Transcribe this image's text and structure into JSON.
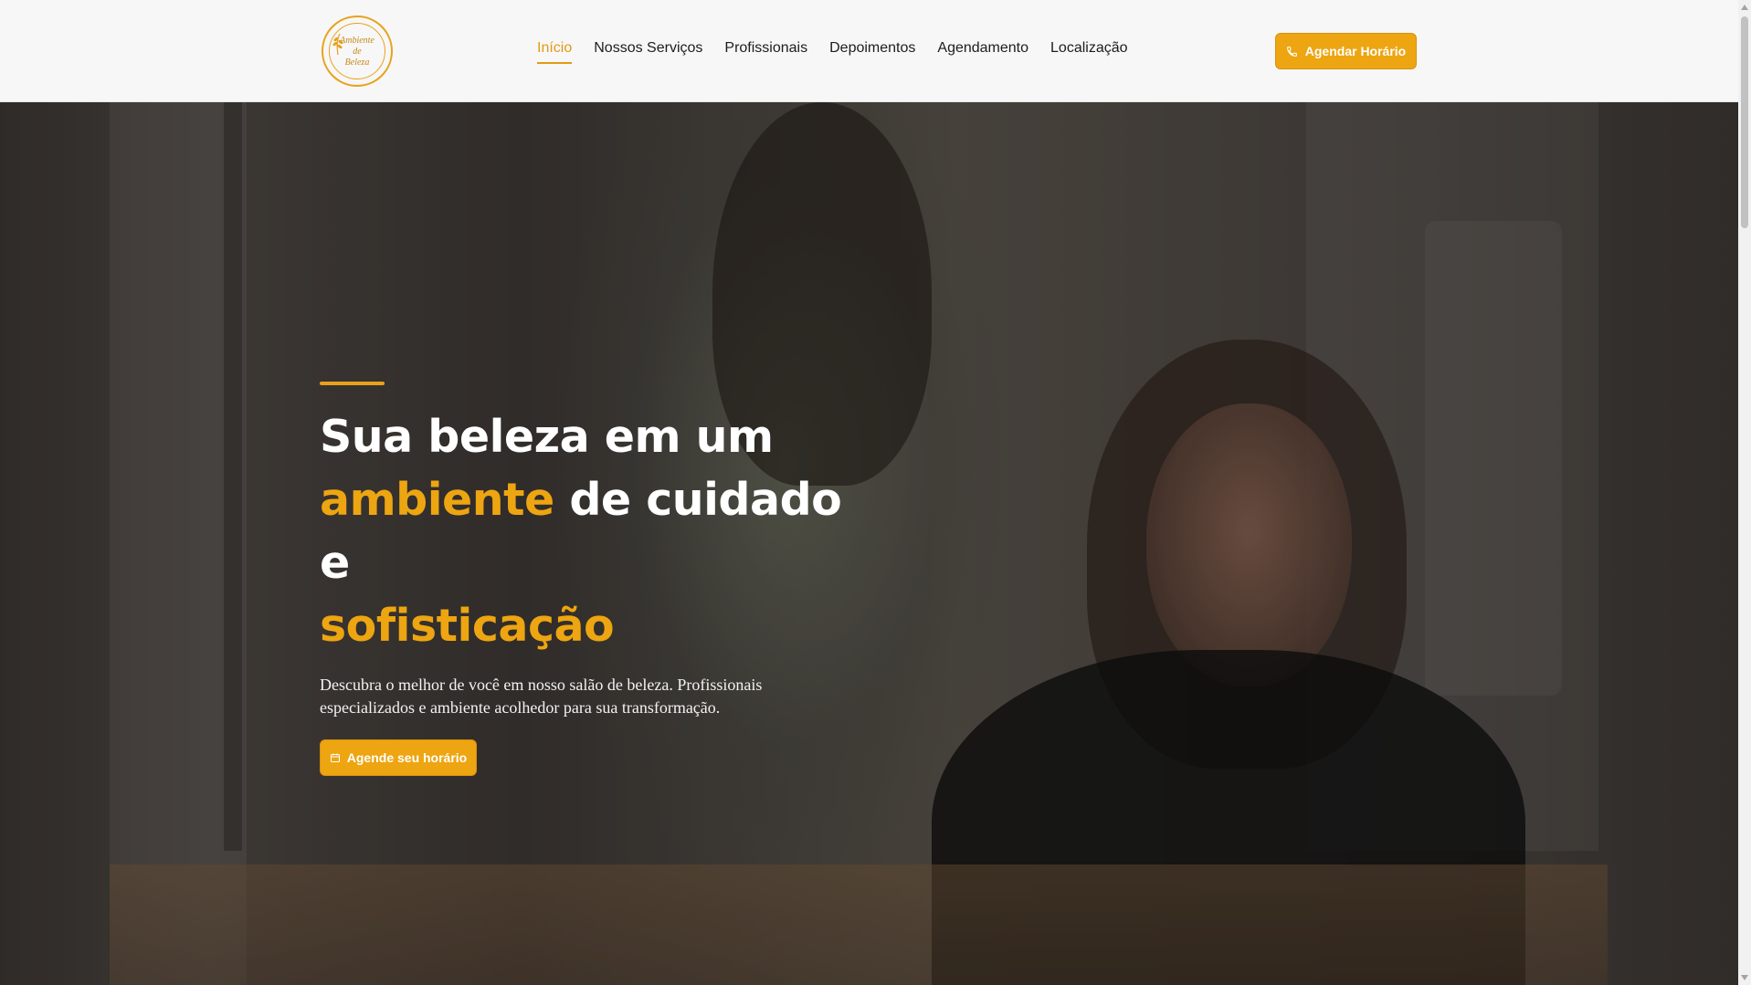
{
  "brand": {
    "logo_text": "Ambiente\nde\nBeleza",
    "accent_color": "#eda511"
  },
  "nav": {
    "items": [
      {
        "label": "Início",
        "active": true
      },
      {
        "label": "Nossos Serviços",
        "active": false
      },
      {
        "label": "Profissionais",
        "active": false
      },
      {
        "label": "Depoimentos",
        "active": false
      },
      {
        "label": "Agendamento",
        "active": false
      },
      {
        "label": "Localização",
        "active": false
      }
    ],
    "cta_label": "Agendar Horário",
    "cta_icon": "phone-icon"
  },
  "hero": {
    "headline_part1": "Sua beleza em um",
    "headline_gold1": "ambiente",
    "headline_part2": " de cuidado e",
    "headline_gold2": "sofisticação",
    "description": "Descubra o melhor de você em nosso salão de beleza. Profissionais especializados e ambiente acolhedor para sua transformação.",
    "cta_label": "Agende seu horário",
    "cta_icon": "calendar-icon"
  }
}
